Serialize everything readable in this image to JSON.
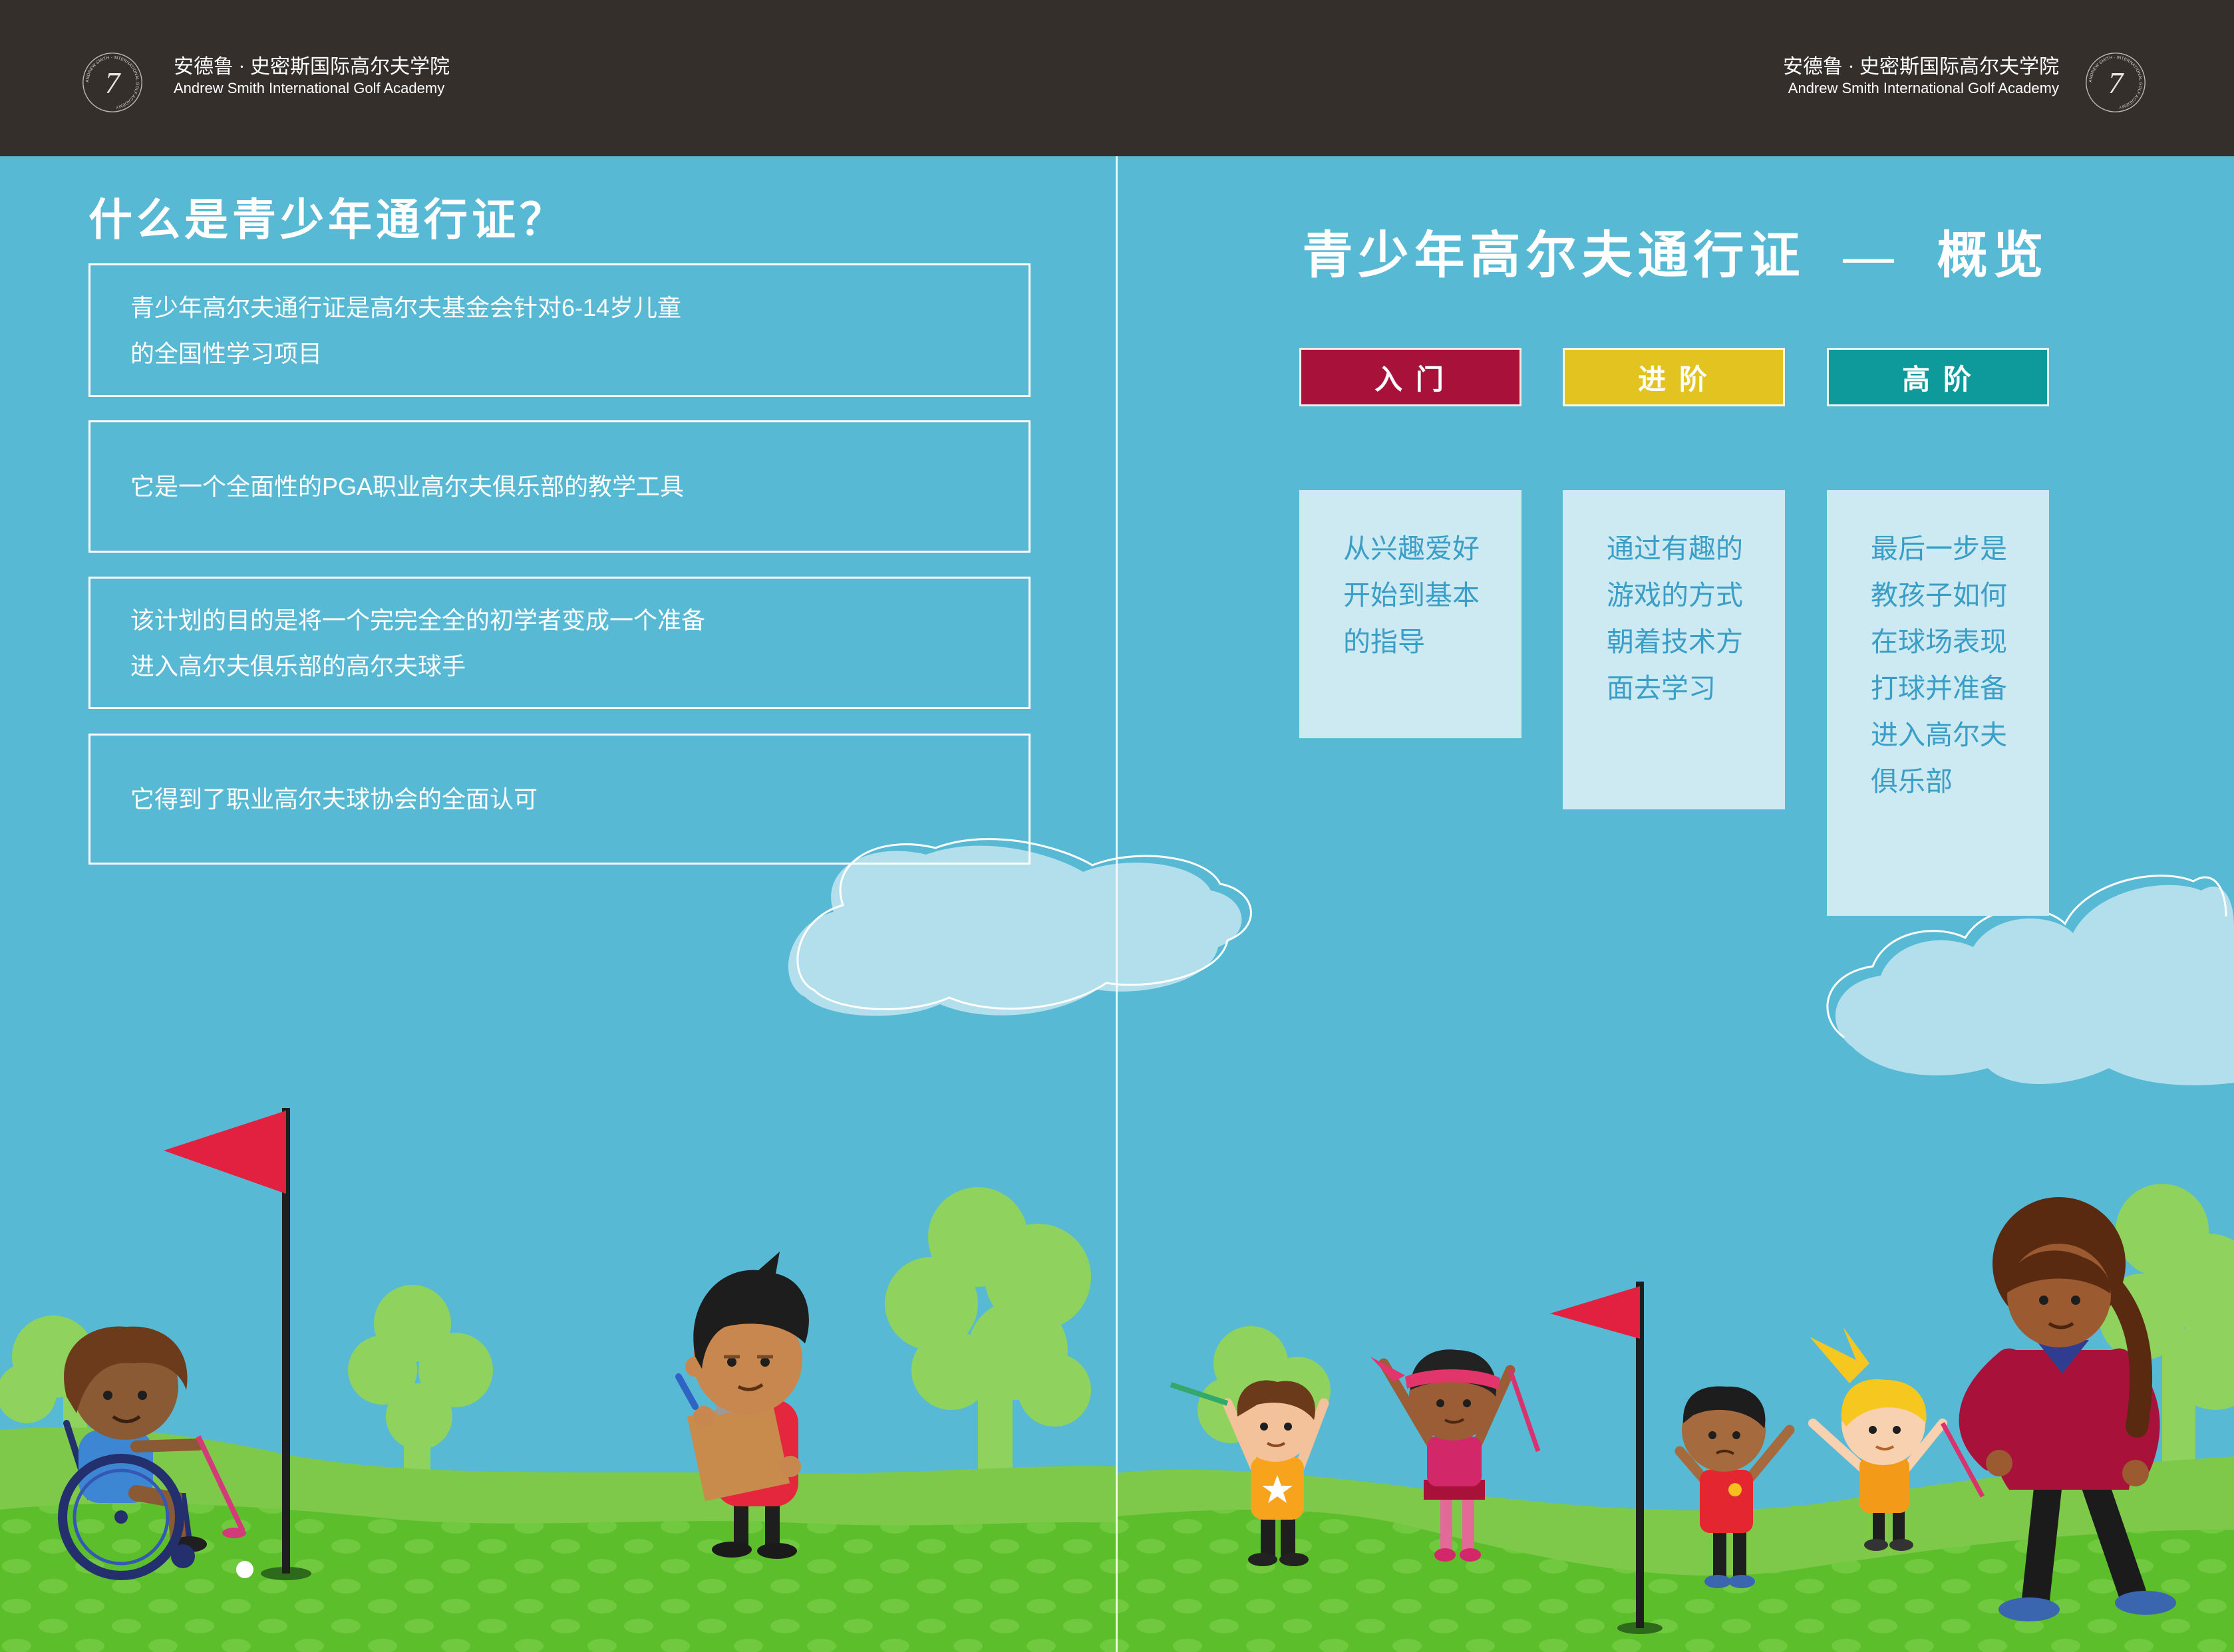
{
  "header": {
    "brand_cn": "安德鲁 · 史密斯国际高尔夫学院",
    "brand_en": "Andrew Smith International Golf Academy",
    "emblem": {
      "numeral": "7",
      "ring_text": "ANDREW SMITH · INTERNATIONAL GOLF ACADEMY"
    }
  },
  "left_page": {
    "title": "什么是青少年通行证？",
    "points": [
      {
        "lines": [
          "青少年高尔夫通行证是高尔夫基金会针对6-14岁儿童",
          "的全国性学习项目"
        ]
      },
      {
        "lines": [
          "它是一个全面性的PGA职业高尔夫俱乐部的教学工具"
        ]
      },
      {
        "lines": [
          "该计划的目的是将一个完完全全的初学者变成一个准备",
          "进入高尔夫俱乐部的高尔夫球手"
        ]
      },
      {
        "lines": [
          "它得到了职业高尔夫球协会的全面认可"
        ]
      }
    ]
  },
  "right_page": {
    "title": "青少年高尔夫通行证 — 概览",
    "levels": [
      {
        "label": "入 门",
        "color": "#a8123a",
        "lines": [
          "从兴趣爱好",
          "开始到基本",
          "的指导"
        ]
      },
      {
        "label": "进 阶",
        "color": "#e3c320",
        "lines": [
          "通过有趣的",
          "游戏的方式",
          "朝着技术方",
          "面去学习"
        ]
      },
      {
        "label": "高 阶",
        "color": "#0e999a",
        "lines": [
          "最后一步是",
          "教孩子如何",
          "在球场表现",
          "打球并准备",
          "进入高尔夫",
          "俱乐部"
        ]
      }
    ]
  },
  "colors": {
    "header_bg": "#352f2c",
    "sky": "#58b9d4",
    "description_bg": "#cde9f1",
    "description_text": "#3b9ec7",
    "flag": "#e2203f"
  }
}
